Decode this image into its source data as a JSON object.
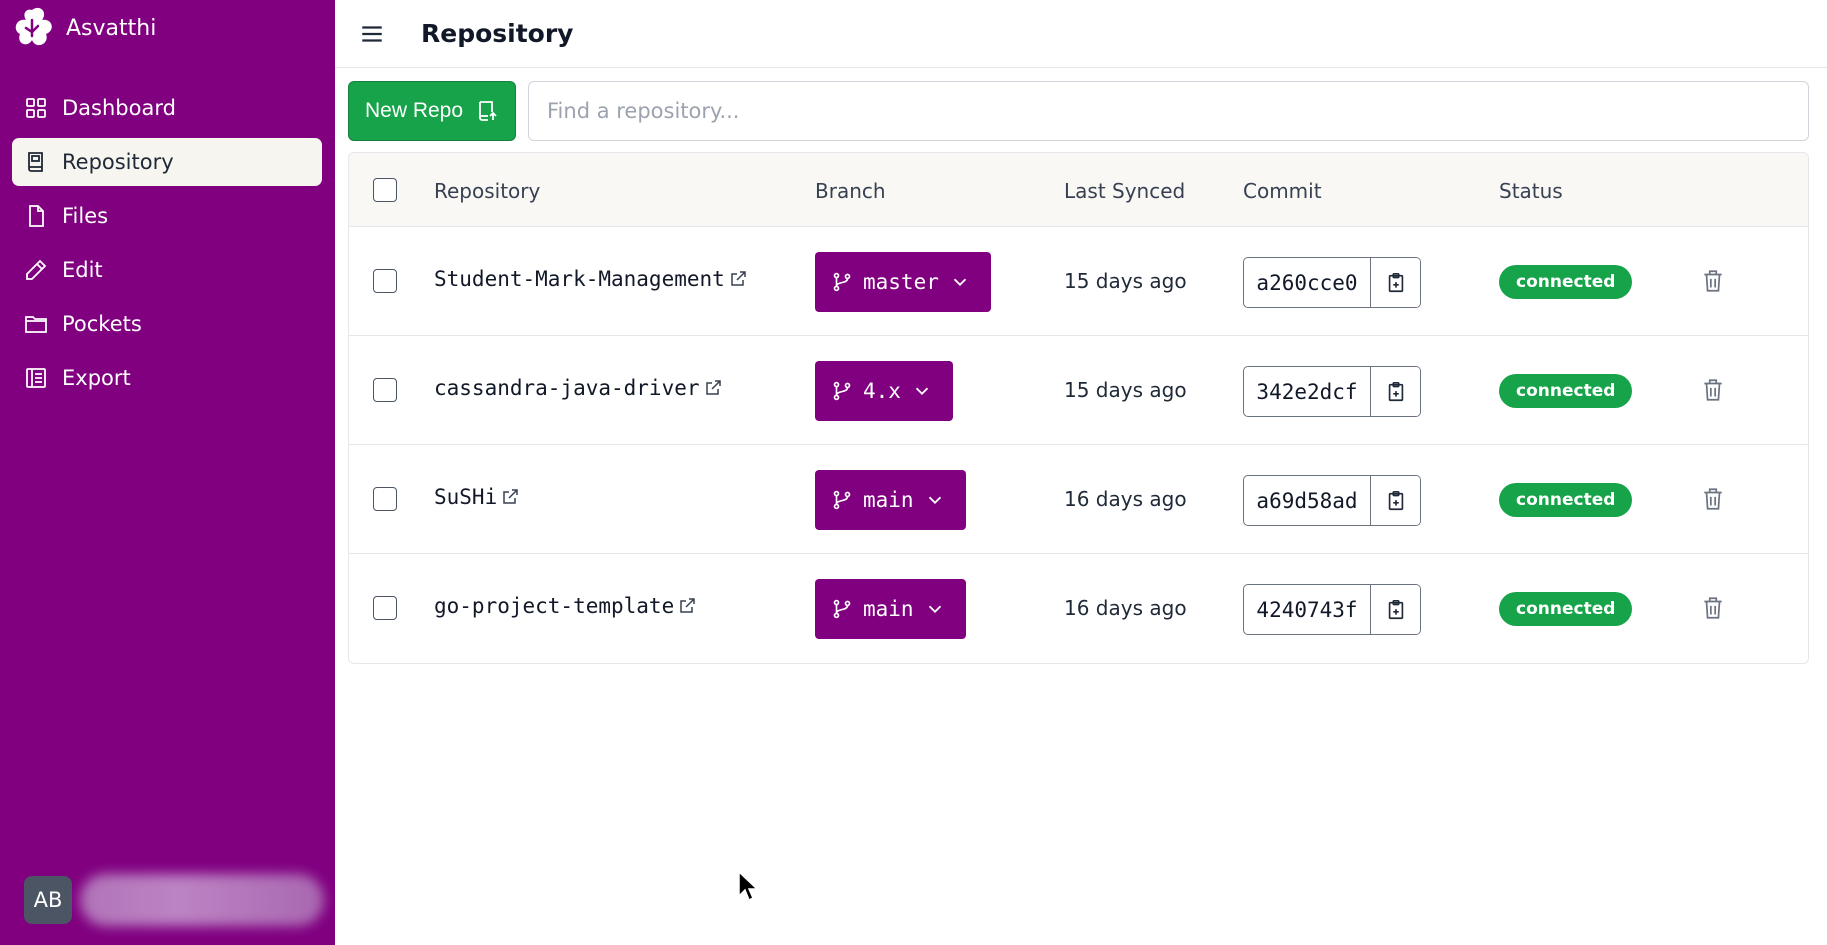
{
  "app": {
    "name": "Asvatthi",
    "accent": "#800080",
    "success": "#16a34a"
  },
  "sidebar": {
    "items": [
      {
        "label": "Dashboard",
        "icon": "grid-icon"
      },
      {
        "label": "Repository",
        "icon": "book-icon",
        "active": true
      },
      {
        "label": "Files",
        "icon": "file-icon"
      },
      {
        "label": "Edit",
        "icon": "pencil-icon"
      },
      {
        "label": "Pockets",
        "icon": "folder-icon"
      },
      {
        "label": "Export",
        "icon": "export-icon"
      }
    ],
    "user": {
      "initials": "AB"
    }
  },
  "header": {
    "title": "Repository"
  },
  "toolbar": {
    "new_repo_label": "New Repo",
    "search_placeholder": "Find a repository..."
  },
  "table": {
    "headers": {
      "repository": "Repository",
      "branch": "Branch",
      "last_synced": "Last Synced",
      "commit": "Commit",
      "status": "Status"
    },
    "rows": [
      {
        "name": "Student-Mark-Management",
        "branch": "master",
        "synced": "15 days ago",
        "commit": "a260cce0",
        "status": "connected"
      },
      {
        "name": "cassandra-java-driver",
        "branch": "4.x",
        "synced": "15 days ago",
        "commit": "342e2dcf",
        "status": "connected"
      },
      {
        "name": "SuSHi",
        "branch": "main",
        "synced": "16 days ago",
        "commit": "a69d58ad",
        "status": "connected"
      },
      {
        "name": "go-project-template",
        "branch": "main",
        "synced": "16 days ago",
        "commit": "4240743f",
        "status": "connected"
      }
    ]
  }
}
